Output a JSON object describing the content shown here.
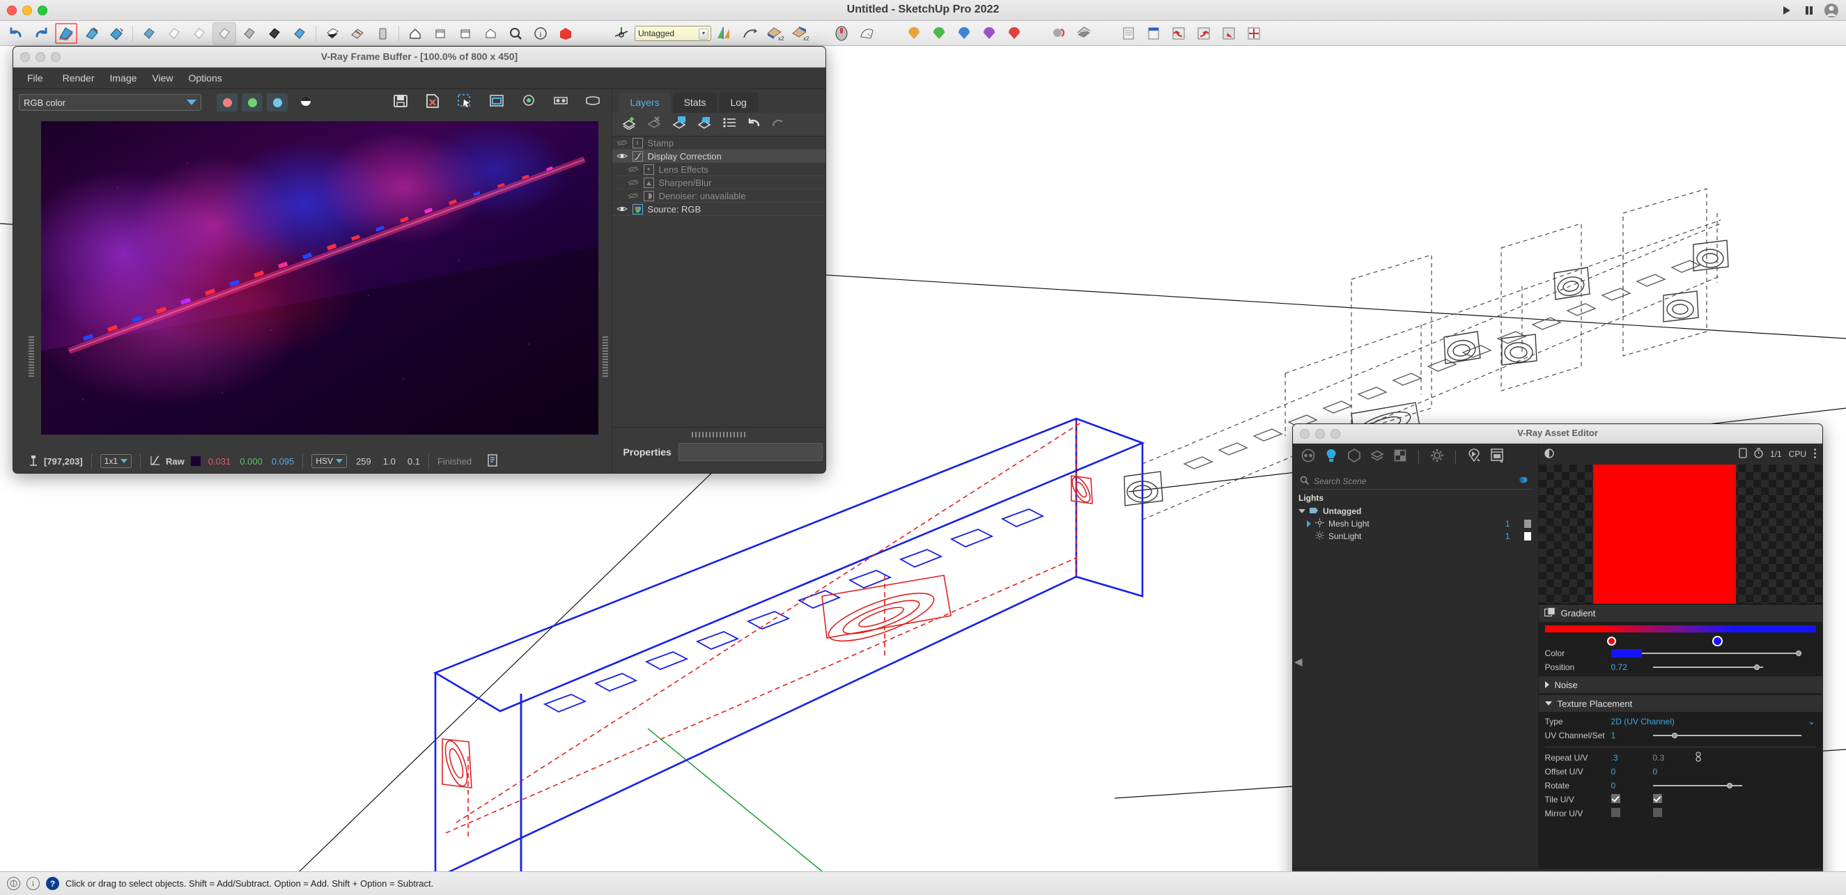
{
  "sketchup": {
    "window_title": "Untitled - SketchUp Pro 2022",
    "tag_selector_value": "Untagged",
    "status_text": "Click or drag to select objects. Shift = Add/Subtract. Option = Add. Shift + Option = Subtract.",
    "toolbar_icons": [
      "undo-icon",
      "redo-icon",
      "select-tool-icon",
      "eraser-tool-icon",
      "paint-bucket-icon",
      "orbit-icon",
      "pan-icon",
      "zoom-icon",
      "zoom-window-icon",
      "zoom-extents-icon",
      "previous-view-icon",
      "next-view-icon",
      "iso-view-icon",
      "top-view-icon",
      "front-view-icon",
      "right-view-icon",
      "left-view-icon",
      "back-view-icon",
      "search-icon",
      "info-icon",
      "sketchup-logo-icon"
    ],
    "vray_toolbar_icons": [
      "vray-render-icon",
      "vray-interactive-icon",
      "vray-render-cloud-icon",
      "vray-batch-icon",
      "vray-asset-editor-icon",
      "vray-frame-buffer-icon",
      "vray-lister-icon"
    ],
    "top_right_buttons": [
      "play-icon",
      "pause-icon",
      "account-icon"
    ]
  },
  "vfb": {
    "title": "V-Ray Frame Buffer - [100.0% of 800 x 450]",
    "menu": [
      "File",
      "Render",
      "Image",
      "View",
      "Options"
    ],
    "channel_select": "RGB color",
    "channel_buttons": [
      "red-channel-icon",
      "green-channel-icon",
      "blue-channel-icon",
      "alpha-channel-icon"
    ],
    "toolbar_icons": [
      "save-image-icon",
      "clear-image-icon",
      "region-render-icon",
      "render-window-icon",
      "color-pick-icon",
      "stereo-icon",
      "vr-icon"
    ],
    "tabs": [
      {
        "label": "Layers",
        "active": true
      },
      {
        "label": "Stats",
        "active": false
      },
      {
        "label": "Log",
        "active": false
      }
    ],
    "layer_toolbar_icons": [
      "add-layer-icon",
      "remove-layer-icon",
      "save-layers-icon",
      "load-layers-icon",
      "layer-presets-icon",
      "undo-icon",
      "redo-icon"
    ],
    "layers": [
      {
        "label": "Stamp",
        "visible": false,
        "icon": "stamp-icon",
        "indent": 0
      },
      {
        "label": "Display Correction",
        "visible": true,
        "icon": "curve-icon",
        "indent": 0
      },
      {
        "label": "Lens Effects",
        "visible": false,
        "icon": "plus-icon",
        "indent": 1
      },
      {
        "label": "Sharpen/Blur",
        "visible": false,
        "icon": "sharpen-icon",
        "indent": 1
      },
      {
        "label": "Denoiser: unavailable",
        "visible": false,
        "icon": "denoiser-icon",
        "indent": 1
      },
      {
        "label": "Source: RGB",
        "visible": true,
        "icon": "rgb-source-icon",
        "indent": 0
      }
    ],
    "properties_label": "Properties",
    "status": {
      "pixel_coords": "[797,203]",
      "zoom": "1x1",
      "mode": "Raw",
      "r": "0.031",
      "g": "0.000",
      "b": "0.095",
      "colorspace": "HSV",
      "h": "259",
      "s": "1.0",
      "v": "0.1",
      "render_state": "Finished"
    }
  },
  "asset_editor": {
    "title": "V-Ray Asset Editor",
    "nav_icons": [
      "materials-icon",
      "lights-icon",
      "geometry-icon",
      "render-elements-icon",
      "textures-icon",
      "settings-icon",
      "render-icon",
      "frame-buffer-icon"
    ],
    "active_nav": "lights-icon",
    "search_placeholder": "Search Scene",
    "section_header": "Lights",
    "tree": [
      {
        "label": "Untagged",
        "count": "",
        "expanded": true,
        "icon": "tag-icon",
        "level": 0
      },
      {
        "label": "Mesh Light",
        "count": "1",
        "expanded": false,
        "icon": "mesh-light-icon",
        "level": 1,
        "swatch": "#9a9a9a"
      },
      {
        "label": "SunLight",
        "count": "1",
        "expanded": false,
        "icon": "sun-light-icon",
        "level": 1,
        "swatch": "#ffffff"
      }
    ],
    "preview": {
      "device": "CPU",
      "ratio": "1/1",
      "color": "#fe0000",
      "icons": [
        "preview-toggle-icon",
        "device-icon",
        "timer-icon",
        "more-options-icon"
      ]
    },
    "gradient": {
      "header": "Gradient",
      "colors": [
        "#ff0000",
        "#1414ff"
      ],
      "stops": [
        {
          "position": 0.27,
          "color": "#ff0000"
        },
        {
          "position": 0.72,
          "color": "#1414ff"
        }
      ],
      "color_label": "Color",
      "color_value": "#1414ff",
      "position_label": "Position",
      "position_value": "0.72"
    },
    "noise_section": "Noise",
    "texture_placement": {
      "header": "Texture Placement",
      "rows": [
        {
          "label": "Type",
          "value": "2D (UV Channel)",
          "type": "dropdown"
        },
        {
          "label": "UV Channel/Set",
          "value": "1",
          "type": "slider",
          "slider_pos": 0.13
        },
        {
          "label": "Repeat U/V",
          "value": ".3",
          "value2": "0.3",
          "type": "pair_link"
        },
        {
          "label": "Offset U/V",
          "value": "0",
          "value2": "0",
          "type": "pair"
        },
        {
          "label": "Rotate",
          "value": "0",
          "type": "slider",
          "slider_pos": 0.5
        },
        {
          "label": "Tile U/V",
          "value": "checked",
          "value2": "checked",
          "type": "checkpair"
        },
        {
          "label": "Mirror U/V",
          "value": "unchecked",
          "value2": "unchecked",
          "type": "checkpair"
        }
      ]
    },
    "footer_icons": [
      "history-icon",
      "open-icon",
      "save-icon",
      "delete-icon",
      "upload-icon",
      "back-arrow-icon",
      "up-arrow-icon"
    ]
  }
}
